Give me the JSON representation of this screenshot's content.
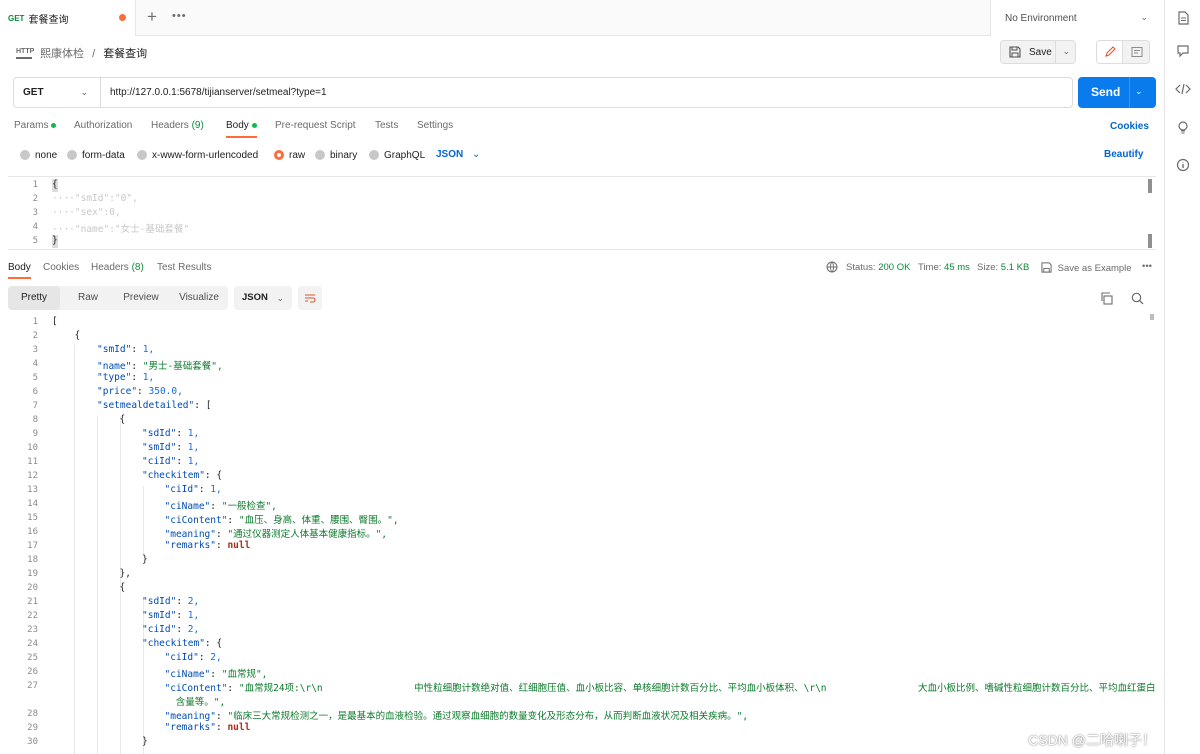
{
  "tab": {
    "method": "GET",
    "title": "套餐查询"
  },
  "tabbar": {
    "plus": "+",
    "more": "•••"
  },
  "environment": {
    "label": "No Environment"
  },
  "breadcrumb": {
    "icon_text": "HTTP",
    "collection": "熙康体检",
    "separator": "/",
    "request": "套餐查询"
  },
  "toolbar": {
    "save_label": "Save"
  },
  "request": {
    "method": "GET",
    "url": "http://127.0.0.1:5678/tijianserver/setmeal?type=1",
    "send_label": "Send"
  },
  "request_tabs": [
    "Params",
    "Authorization",
    "Headers",
    "(9)",
    "Body",
    "Pre-request Script",
    "Tests",
    "Settings"
  ],
  "cookies_link": "Cookies",
  "body_types": [
    "none",
    "form-data",
    "x-www-form-urlencoded",
    "raw",
    "binary",
    "GraphQL"
  ],
  "body_format": "JSON",
  "beautify": "Beautify",
  "request_body": {
    "line_numbers": [
      "1",
      "2",
      "3",
      "4",
      "5"
    ],
    "lines": [
      "{",
      "····\"smId\":\"0\",",
      "····\"sex\":0,",
      "····\"name\":\"女士-基础套餐\"",
      "}"
    ]
  },
  "response_tabs": [
    "Body",
    "Cookies",
    "Headers",
    "(8)",
    "Test Results"
  ],
  "response_status": {
    "status_label": "Status:",
    "status": "200 OK",
    "time_label": "Time:",
    "time": "45 ms",
    "size_label": "Size:",
    "size": "5.1 KB",
    "save_example": "Save as Example",
    "more": "•••"
  },
  "view_modes": [
    "Pretty",
    "Raw",
    "Preview",
    "Visualize"
  ],
  "response_format": "JSON",
  "response_body": {
    "line_numbers": [
      "1",
      "2",
      "3",
      "4",
      "5",
      "6",
      "7",
      "8",
      "9",
      "10",
      "11",
      "12",
      "13",
      "14",
      "15",
      "16",
      "17",
      "18",
      "19",
      "20",
      "21",
      "22",
      "23",
      "24",
      "25",
      "26",
      "27",
      "",
      "28",
      "29",
      "30"
    ],
    "lines": [
      "[",
      "{",
      "\"smId\": 1,",
      "\"name\": \"男士-基础套餐\",",
      "\"type\": 1,",
      "\"price\": 350.0,",
      "\"setmealdetailed\": [",
      "{",
      "\"sdId\": 1,",
      "\"smId\": 1,",
      "\"ciId\": 1,",
      "\"checkitem\": {",
      "\"ciId\": 1,",
      "\"ciName\": \"一般检查\",",
      "\"ciContent\": \"血压、身高、体重、腰围、臀围。\",",
      "\"meaning\": \"通过仪器测定人体基本健康指标。\",",
      "\"remarks\": null",
      "}",
      "},",
      "{",
      "\"sdId\": 2,",
      "\"smId\": 1,",
      "\"ciId\": 2,",
      "\"checkitem\": {",
      "\"ciId\": 2,",
      "\"ciName\": \"血常规\",",
      "\"ciContent\": \"血常规24项:\\r\\n                中性粒细胞计数绝对值、红细胞压值、血小板比容、单核细胞计数百分比、平均血小板体积、\\r\\n                大血小板比例、嗜碱性粒细胞计数百分比、平均血红蛋白",
      "含量等。\",",
      "\"meaning\": \"临床三大常规检测之一，是最基本的血液检验。通过观察血细胞的数量变化及形态分布，从而判断血液状况及相关疾病。\",",
      "\"remarks\": null",
      "}"
    ]
  },
  "watermark": "CSDN @二哈喇子！"
}
